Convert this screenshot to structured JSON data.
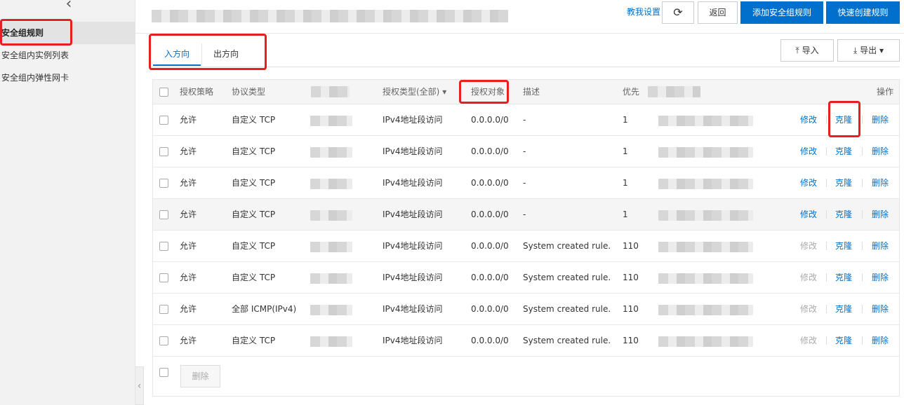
{
  "sidebar": {
    "back_icon": "chevron-left-icon",
    "items": [
      {
        "label": "安全组规则",
        "active": true
      },
      {
        "label": "安全组内实例列表",
        "active": false
      },
      {
        "label": "安全组内弹性网卡",
        "active": false
      }
    ]
  },
  "header": {
    "help_link": "教我设置",
    "refresh_icon": "refresh-icon",
    "back_label": "返回",
    "add_label": "添加安全组规则",
    "quick_label": "快速创建规则"
  },
  "tabs": {
    "inbound": "入方向",
    "outbound": "出方向"
  },
  "toolbar": {
    "import_label": "导入",
    "export_label": "导出"
  },
  "table": {
    "headers": {
      "policy": "授权策略",
      "protocol": "协议类型",
      "auth_type": "授权类型(全部)",
      "auth_object": "授权对象",
      "description": "描述",
      "priority": "优先",
      "actions": "操作"
    },
    "action_labels": {
      "edit": "修改",
      "clone": "克隆",
      "delete": "删除"
    },
    "rows": [
      {
        "policy": "允许",
        "protocol": "自定义 TCP",
        "auth_type": "IPv4地址段访问",
        "auth_object": "0.0.0.0/0",
        "description": "-",
        "priority": "1",
        "edit_enabled": true
      },
      {
        "policy": "允许",
        "protocol": "自定义 TCP",
        "auth_type": "IPv4地址段访问",
        "auth_object": "0.0.0.0/0",
        "description": "-",
        "priority": "1",
        "edit_enabled": true
      },
      {
        "policy": "允许",
        "protocol": "自定义 TCP",
        "auth_type": "IPv4地址段访问",
        "auth_object": "0.0.0.0/0",
        "description": "-",
        "priority": "1",
        "edit_enabled": true
      },
      {
        "policy": "允许",
        "protocol": "自定义 TCP",
        "auth_type": "IPv4地址段访问",
        "auth_object": "0.0.0.0/0",
        "description": "-",
        "priority": "1",
        "edit_enabled": true
      },
      {
        "policy": "允许",
        "protocol": "自定义 TCP",
        "auth_type": "IPv4地址段访问",
        "auth_object": "0.0.0.0/0",
        "description": "System created rule.",
        "priority": "110",
        "edit_enabled": false
      },
      {
        "policy": "允许",
        "protocol": "自定义 TCP",
        "auth_type": "IPv4地址段访问",
        "auth_object": "0.0.0.0/0",
        "description": "System created rule.",
        "priority": "110",
        "edit_enabled": false
      },
      {
        "policy": "允许",
        "protocol": "全部 ICMP(IPv4)",
        "auth_type": "IPv4地址段访问",
        "auth_object": "0.0.0.0/0",
        "description": "System created rule.",
        "priority": "110",
        "edit_enabled": false
      },
      {
        "policy": "允许",
        "protocol": "自定义 TCP",
        "auth_type": "IPv4地址段访问",
        "auth_object": "0.0.0.0/0",
        "description": "System created rule.",
        "priority": "110",
        "edit_enabled": false
      }
    ],
    "footer_delete_label": "删除"
  },
  "colors": {
    "accent": "#0070cc",
    "annotation": "#e61f1f"
  }
}
